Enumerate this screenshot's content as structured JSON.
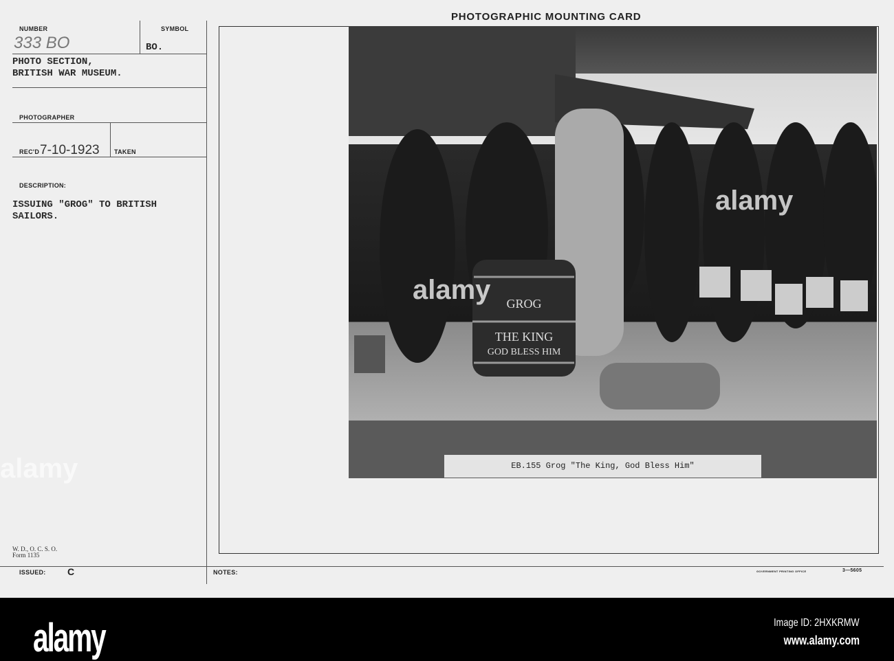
{
  "card": {
    "title": "PHOTOGRAPHIC MOUNTING CARD",
    "number_label": "NUMBER",
    "number_value": "333 BO",
    "symbol_label": "SYMBOL",
    "symbol_value": "BO.",
    "source": "PHOTO SECTION,\nBRITISH WAR MUSEUM.",
    "photographer_label": "PHOTOGRAPHER",
    "recd_label": "REC'D",
    "recd_value": "7-10-1923",
    "taken_label": "TAKEN",
    "description_label": "DESCRIPTION:",
    "description": "ISSUING \"GROG\" TO BRITISH\nSAILORS.",
    "form_id": "W. D., O. C. S. O.\nForm 1135",
    "issued_label": "ISSUED:",
    "issued_value": "C",
    "notes_label": "NOTES:",
    "printer": "GOVERNMENT PRINTING OFFICE",
    "form_code": "3—5605"
  },
  "photo": {
    "barrel_text": [
      "GROG",
      "THE KING",
      "GOD BLESS HIM"
    ],
    "caption": "EB.155   Grog  \"The King, God Bless Him\""
  },
  "watermark": {
    "logo": "alamy",
    "image_id": "Image ID: 2HXKRMW",
    "url": "www.alamy.com"
  }
}
